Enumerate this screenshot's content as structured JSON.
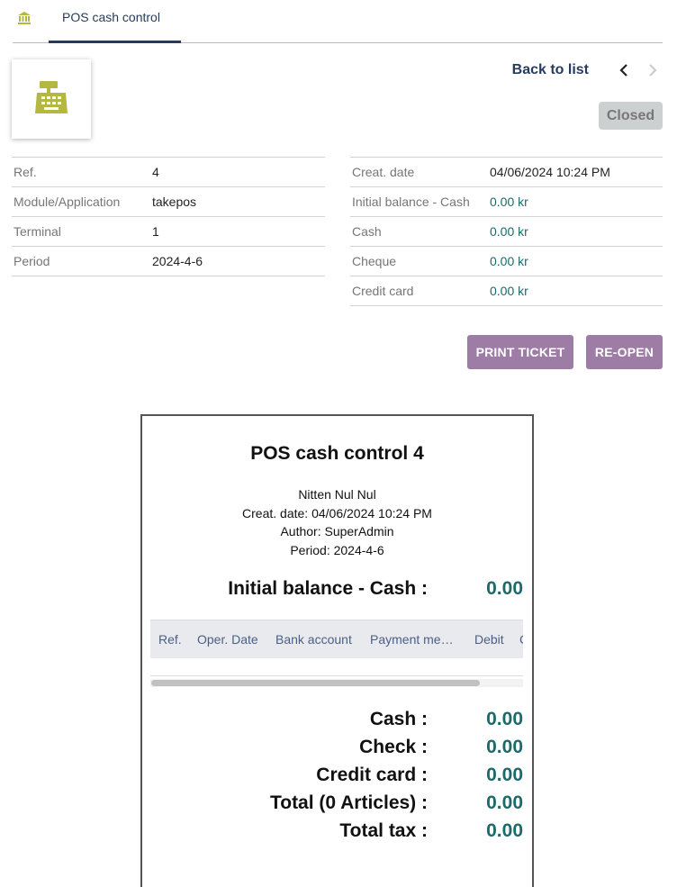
{
  "tabs": {
    "active_label": "POS cash control"
  },
  "nav": {
    "back_label": "Back to list"
  },
  "status": {
    "label": "Closed"
  },
  "left_fields": [
    {
      "label": "Ref.",
      "value": "4"
    },
    {
      "label": "Module/Application",
      "value": "takepos"
    },
    {
      "label": "Terminal",
      "value": "1"
    },
    {
      "label": "Period",
      "value": "2024-4-6"
    }
  ],
  "right_fields": [
    {
      "label": "Creat. date",
      "value": "04/06/2024 10:24 PM"
    },
    {
      "label": "Initial balance - Cash",
      "value": "0.00 kr"
    },
    {
      "label": "Cash",
      "value": "0.00 kr"
    },
    {
      "label": "Cheque",
      "value": "0.00 kr"
    },
    {
      "label": "Credit card",
      "value": "0.00 kr"
    }
  ],
  "actions": {
    "print_label": "PRINT TICKET",
    "reopen_label": "RE-OPEN"
  },
  "ticket": {
    "title": "POS cash control 4",
    "company": "Nitten Nul Nul",
    "creat_date": "Creat. date: 04/06/2024 10:24 PM",
    "author": "Author: SuperAdmin",
    "period": "Period: 2024-4-6",
    "initial_label": "Initial balance - Cash :",
    "initial_value": "0.00",
    "columns": [
      "Ref.",
      "Oper. Date",
      "Bank account",
      "Payment me…",
      "Debit",
      "C"
    ],
    "totals": [
      {
        "label": "Cash :",
        "value": "0.00"
      },
      {
        "label": "Check :",
        "value": "0.00"
      },
      {
        "label": "Credit card :",
        "value": "0.00"
      },
      {
        "label": "Total (0 Articles) :",
        "value": "0.00"
      },
      {
        "label": "Total tax :",
        "value": "0.00"
      }
    ]
  },
  "colors": {
    "accent": "#263c5c",
    "button": "#9d7ca6",
    "money": "#1c6a6a",
    "icon": "#b5b840"
  },
  "icons": {
    "tab_icon": "bank-icon",
    "logo_icon": "cash-register-icon",
    "prev_icon": "chevron-left-icon",
    "next_icon": "chevron-right-icon"
  }
}
